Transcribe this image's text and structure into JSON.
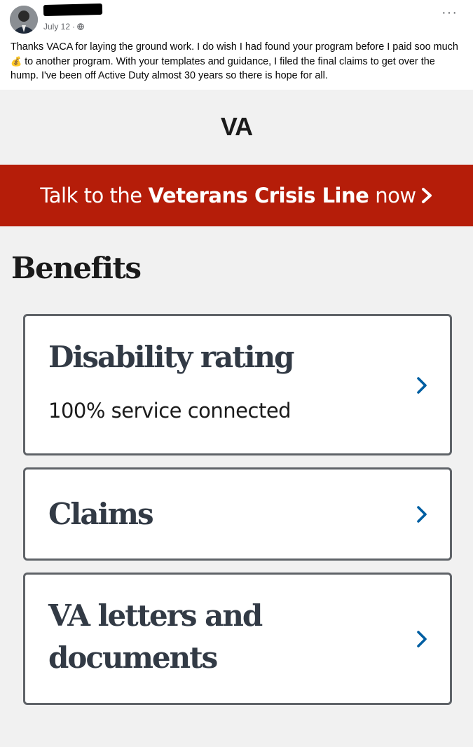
{
  "post": {
    "date": "July 12",
    "separator": "·",
    "more_label": "···",
    "text_part1": "Thanks VACA for laying the ground work. I do wish I had found your program before I paid soo much",
    "money_bag": "💰",
    "text_part2": "to another program. With your templates and guidance, I filed the final claims to get over the hump. I've been off Active Duty almost 30 years so there is hope for all."
  },
  "va_app": {
    "logo": "VA",
    "crisis_line": {
      "prefix": "Talk to the",
      "emphasis": "Veterans Crisis Line",
      "suffix": "now"
    },
    "section_title": "Benefits",
    "cards": [
      {
        "title": "Disability rating",
        "subtitle": "100% service connected"
      },
      {
        "title": "Claims"
      },
      {
        "title_line1": "VA letters and",
        "title_line2": "documents"
      }
    ]
  },
  "colors": {
    "crisis_red": "#b51d09",
    "chevron_blue": "#005ea2",
    "card_border": "#5f6368",
    "background": "#f1f1f1"
  }
}
